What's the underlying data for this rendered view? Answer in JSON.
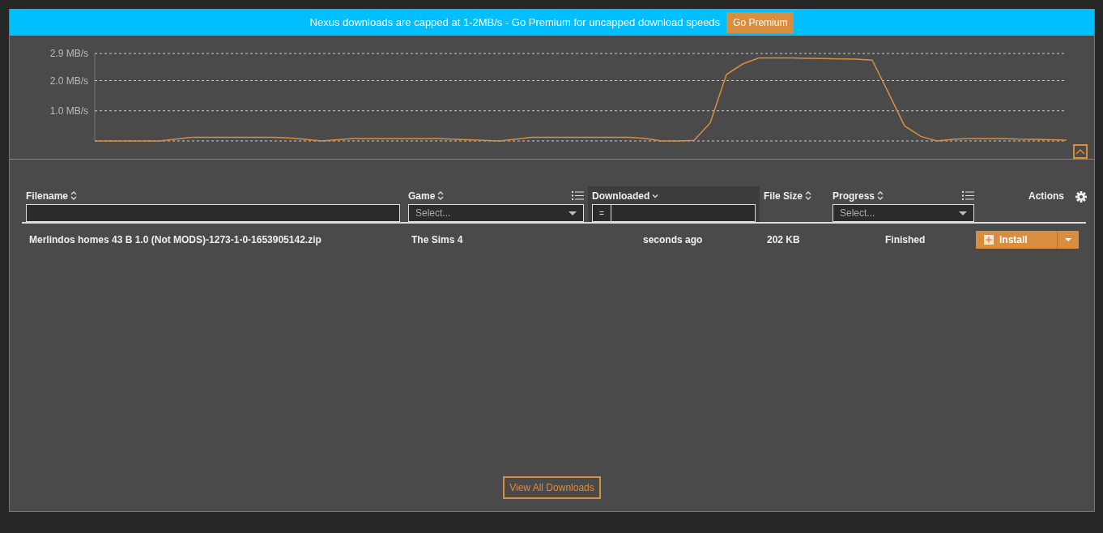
{
  "banner": {
    "message": "Nexus downloads are capped at 1-2MB/s - Go Premium for uncapped download speeds",
    "button": "Go Premium"
  },
  "speed_graph": {
    "collapse_expanded": true,
    "chart_data": {
      "type": "line",
      "ylim": [
        0,
        2.9
      ],
      "yticks": [
        {
          "value": 1.0,
          "label": "1.0 MB/s"
        },
        {
          "value": 2.0,
          "label": "2.0 MB/s"
        },
        {
          "value": 2.9,
          "label": "2.9 MB/s"
        }
      ],
      "series": [
        {
          "color": "#d98e3f",
          "values": [
            0,
            0,
            0,
            0,
            0,
            0.06,
            0.12,
            0.12,
            0.12,
            0.12,
            0.12,
            0.12,
            0.1,
            0.05,
            0,
            0.04,
            0.08,
            0.08,
            0.08,
            0.08,
            0.08,
            0.08,
            0.06,
            0.04,
            0.02,
            0,
            0.06,
            0.12,
            0.12,
            0.12,
            0.12,
            0.12,
            0.12,
            0.12,
            0.08,
            0,
            0,
            0.02,
            0.6,
            2.2,
            2.55,
            2.75,
            2.75,
            2.75,
            2.74,
            2.73,
            2.72,
            2.71,
            2.68,
            1.6,
            0.5,
            0.15,
            0,
            0.05,
            0.08,
            0.08,
            0.08,
            0.06,
            0.05,
            0.04,
            0.03
          ]
        }
      ]
    }
  },
  "table": {
    "columns": [
      {
        "label": "Filename",
        "kind": "text",
        "sorted": false
      },
      {
        "label": "Game",
        "kind": "select",
        "placeholder": "Select...",
        "sorted": false
      },
      {
        "label": "Downloaded",
        "kind": "date",
        "operator": "=",
        "sorted": true
      },
      {
        "label": "File Size",
        "kind": "plain",
        "sorted": false
      },
      {
        "label": "Progress",
        "kind": "select",
        "placeholder": "Select...",
        "sorted": false
      },
      {
        "label": "Actions",
        "kind": "actions"
      }
    ],
    "rows": [
      {
        "filename": "Merlindos homes 43 B 1.0 (Not MODS)-1273-1-0-1653905142.zip",
        "game": "The Sims 4",
        "downloaded": "seconds ago",
        "file_size": "202 KB",
        "progress": "Finished",
        "action": "Install"
      }
    ]
  },
  "footer_button": "View All Downloads"
}
